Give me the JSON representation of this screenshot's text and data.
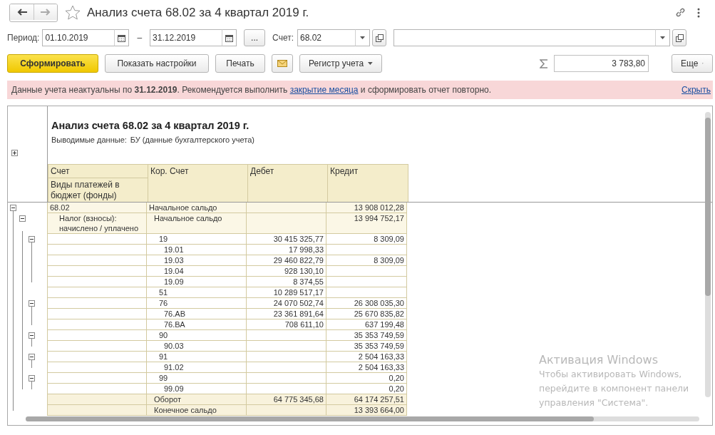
{
  "window": {
    "title": "Анализ счета 68.02 за 4 квартал 2019 г."
  },
  "filters": {
    "period_label": "Период:",
    "date_from": "01.10.2019",
    "dash": "–",
    "date_to": "31.12.2019",
    "more_button": "...",
    "account_label": "Счет:",
    "account": "68.02"
  },
  "toolbar": {
    "generate": "Сформировать",
    "settings": "Показать настройки",
    "print": "Печать",
    "register": "Регистр учета",
    "sum": "3 783,80",
    "more": "Еще"
  },
  "notice": {
    "text_before": "Данные учета неактуальны по **31.12.2019**. Рекомендуется выполнить",
    "link": "закрытие месяца",
    "text_after": "и сформировать отчет повторно.",
    "hide": "Скрыть"
  },
  "report": {
    "title": "Анализ счета 68.02 за 4 квартал 2019 г.",
    "output_label": "Выводимые данные:",
    "output_value": "БУ (данные бухгалтерского учета)",
    "settings_expanded": false,
    "columns": [
      {
        "title": "Счет",
        "subtitle": "Виды платежей в бюджет (фонды)"
      },
      {
        "title": "Кор. Счет"
      },
      {
        "title": "Дебет"
      },
      {
        "title": "Кредит"
      }
    ],
    "rows": [
      {
        "kind": "opening",
        "account": "68.02",
        "cor": "Начальное сальдо",
        "credit": "13 908 012,28",
        "expanded": true,
        "children": [
          {
            "kind": "opening",
            "account": "Налог (взносы): начислено / уплачено",
            "cor": "Начальное сальдо",
            "credit": "13 994 752,17",
            "expanded": true,
            "children": [
              {
                "kind": "line",
                "cor": "19",
                "debit": "30 415 325,77",
                "credit": "8 309,09",
                "expanded": true,
                "children": [
                  {
                    "kind": "line",
                    "cor": "19.01",
                    "debit": "17 998,33"
                  },
                  {
                    "kind": "line",
                    "cor": "19.03",
                    "debit": "29 460 822,79",
                    "credit": "8 309,09"
                  },
                  {
                    "kind": "line",
                    "cor": "19.04",
                    "debit": "928 130,10"
                  },
                  {
                    "kind": "line",
                    "cor": "19.09",
                    "debit": "8 374,55"
                  }
                ]
              },
              {
                "kind": "line",
                "cor": "51",
                "debit": "10 289 517,17"
              },
              {
                "kind": "line",
                "cor": "76",
                "debit": "24 070 502,74",
                "credit": "26 308 035,30",
                "expanded": true,
                "children": [
                  {
                    "kind": "line",
                    "cor": "76.АВ",
                    "debit": "23 361 891,64",
                    "credit": "25 670 835,82"
                  },
                  {
                    "kind": "line",
                    "cor": "76.ВА",
                    "debit": "708 611,10",
                    "credit": "637 199,48"
                  }
                ]
              },
              {
                "kind": "line",
                "cor": "90",
                "credit": "35 353 749,59",
                "expanded": true,
                "children": [
                  {
                    "kind": "line",
                    "cor": "90.03",
                    "credit": "35 353 749,59"
                  }
                ]
              },
              {
                "kind": "line",
                "cor": "91",
                "credit": "2 504 163,33",
                "expanded": true,
                "children": [
                  {
                    "kind": "line",
                    "cor": "91.02",
                    "credit": "2 504 163,33"
                  }
                ]
              },
              {
                "kind": "line",
                "cor": "99",
                "credit": "0,20",
                "expanded": true,
                "children": [
                  {
                    "kind": "line",
                    "cor": "99.09",
                    "credit": "0,20"
                  }
                ]
              }
            ]
          },
          {
            "kind": "total",
            "cor": "Оборот",
            "debit": "64 775 345,68",
            "credit": "64 174 257,51"
          },
          {
            "kind": "total",
            "cor": "Конечное сальдо",
            "credit": "13 393 664,00"
          }
        ]
      }
    ]
  },
  "os_notice": {
    "title": "Активация Windows",
    "text": "Чтобы активировать Windows, перейдите в компонент панели управления \"Система\"."
  }
}
